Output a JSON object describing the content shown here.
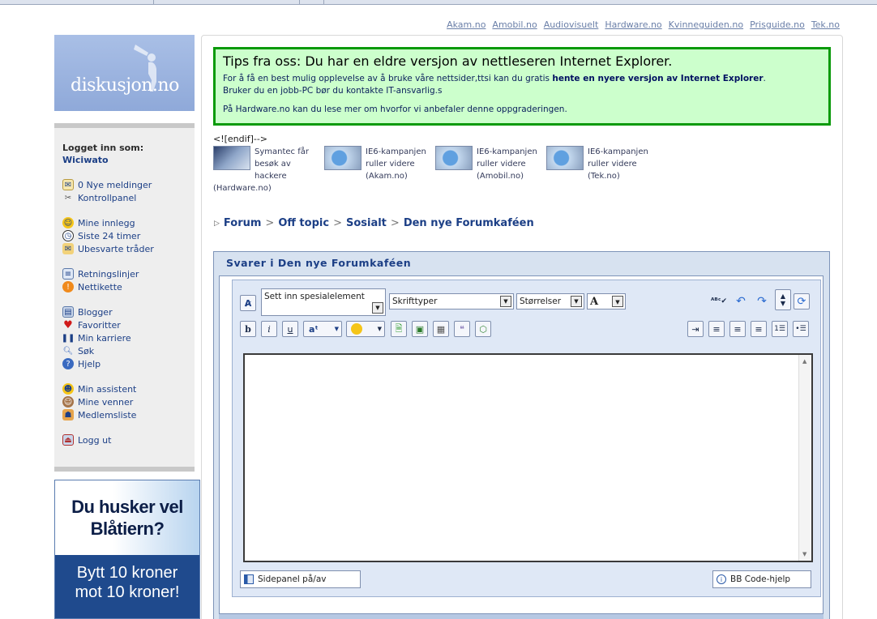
{
  "top_links": [
    "Akam.no",
    "Amobil.no",
    "Audiovisuelt",
    "Hardware.no",
    "Kvinneguiden.no",
    "Prisguide.no",
    "Tek.no"
  ],
  "logo": {
    "text": "diskusjon.no"
  },
  "sidebar": {
    "login_label": "Logget inn som:",
    "username": "Wiciwato",
    "items": [
      {
        "label": "0 Nye meldinger",
        "icon": "envelope-icon"
      },
      {
        "label": "Kontrollpanel",
        "icon": "tools-icon"
      },
      {
        "label": "Mine innlegg",
        "icon": "smiley-icon"
      },
      {
        "label": "Siste 24 timer",
        "icon": "clock-icon"
      },
      {
        "label": "Ubesvarte tråder",
        "icon": "unanswered-icon"
      },
      {
        "label": "Retningslinjer",
        "icon": "document-icon"
      },
      {
        "label": "Nettikette",
        "icon": "warning-icon"
      },
      {
        "label": "Blogger",
        "icon": "blog-icon"
      },
      {
        "label": "Favoritter",
        "icon": "heart-icon"
      },
      {
        "label": "Min karriere",
        "icon": "footsteps-icon"
      },
      {
        "label": "Søk",
        "icon": "magnifier-icon"
      },
      {
        "label": "Hjelp",
        "icon": "help-icon"
      },
      {
        "label": "Min assistent",
        "icon": "assistant-icon"
      },
      {
        "label": "Mine venner",
        "icon": "friends-icon"
      },
      {
        "label": "Medlemsliste",
        "icon": "members-icon"
      },
      {
        "label": "Logg ut",
        "icon": "logout-icon"
      }
    ]
  },
  "ad": {
    "top_lines": [
      "Du husker vel",
      "Blåtiern?"
    ],
    "bottom_lines": [
      "Bytt 10 kroner",
      "mot 10 kroner!"
    ]
  },
  "tips": {
    "title": "Tips fra oss: Du har en eldre versjon av nettleseren Internet Explorer.",
    "line1_pre": "For å få en best mulig opplevelse av å bruke våre nettsider,ttsi kan du gratis ",
    "line1_link": "hente en nyere versjon av Internet Explorer",
    "line1_post": ".",
    "line2": "Bruker du en jobb-PC bør du kontakte IT-ansvarlig.s",
    "line3": "På Hardware.no kan du lese mer om hvorfor vi anbefaler denne oppgraderingen."
  },
  "endif_text": "<![endif]-->",
  "news": [
    {
      "lines": [
        "Symantec får",
        "besøk av",
        "hackere"
      ],
      "source": "(Hardware.no)"
    },
    {
      "lines": [
        "IE6-kampanjen",
        "ruller videre",
        "(Akam.no)"
      ],
      "source": ""
    },
    {
      "lines": [
        "IE6-kampanjen",
        "ruller videre",
        "(Amobil.no)"
      ],
      "source": ""
    },
    {
      "lines": [
        "IE6-kampanjen",
        "ruller videre",
        "(Tek.no)"
      ],
      "source": ""
    }
  ],
  "breadcrumb": [
    "Forum",
    "Off topic",
    "Sosialt",
    "Den nye Forumkaféen"
  ],
  "reply": {
    "title": "Svarer i Den nye Forumkaféen",
    "special_select": "Sett inn spesialelement",
    "font_select": "Skrifttyper",
    "size_select": "Størrelser",
    "sidepanel_button": "Sidepanel på/av",
    "bbcode_button": "BB Code-hjelp",
    "textarea_value": ""
  },
  "colors": {
    "link": "#1c3f86",
    "tips_bg": "#ccffcc",
    "tips_border": "#0a9a0a",
    "panel_bg": "#d7e2f0"
  }
}
